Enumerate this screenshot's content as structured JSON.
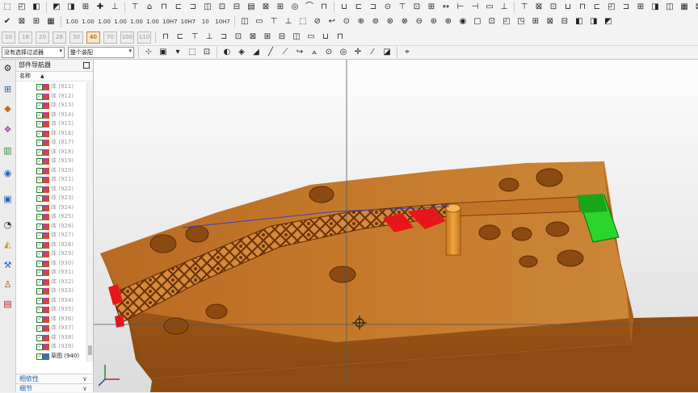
{
  "toolbar_row1": [
    "⬚",
    "◰",
    "◧",
    "◩",
    "◨",
    "⊞",
    "✚",
    "⊥",
    "⊤",
    "⌂",
    "⊓",
    "⊏",
    "⊐",
    "◫",
    "⊡",
    "⊟",
    "▤",
    "⊠",
    "⊞",
    "◎",
    "⌒",
    "⊓",
    "⊔",
    "⊏",
    "⊐",
    "⊙",
    "⊤",
    "⊡",
    "⊞",
    "↔",
    "⊢",
    "⊣",
    "▭",
    "⊥",
    "⊤",
    "⊠",
    "⊡",
    "⊔",
    "⊓",
    "⊏",
    "◰",
    "⊐",
    "⊞",
    "◨",
    "◫",
    "▦",
    "⊠",
    "⊡"
  ],
  "toolbar_row2_dims": [
    "1.00",
    "1.00",
    "1.00",
    "1.00",
    "1.00",
    "1.00",
    "10H7",
    "10H7",
    "10",
    "10H7"
  ],
  "toolbar_row2_icons": [
    "✔",
    "⊠",
    "⊞",
    "▦",
    "◫",
    "▭",
    "⊤",
    "⊥",
    "⬚",
    "⊘",
    "↩",
    "⊙",
    "⊕",
    "⊚",
    "⊛",
    "⊗",
    "⊖",
    "⊛",
    "⊕",
    "◉",
    "▢",
    "⊡",
    "◰",
    "◳",
    "⊞",
    "⊠",
    "⊟",
    "◧",
    "◨",
    "◩"
  ],
  "toolbar_row3_numbers": [
    "10",
    "18",
    "20",
    "28",
    "30",
    "40",
    "70",
    "100",
    "110"
  ],
  "toolbar_row3_icons": [
    "⊓",
    "⊏",
    "⊤",
    "⊥",
    "⊐",
    "⊡",
    "⊠",
    "⊞",
    "⊟",
    "◫",
    "▭",
    "⊔",
    "⊓"
  ],
  "filter": {
    "value": "没有选择过滤器"
  },
  "assembly": {
    "value": "整个装配"
  },
  "navigator": {
    "title": "部件导航器",
    "column_name": "名称"
  },
  "tree_items": [
    {
      "label": "体 (911)"
    },
    {
      "label": "体 (912)"
    },
    {
      "label": "体 (913)"
    },
    {
      "label": "体 (914)"
    },
    {
      "label": "体 (915)"
    },
    {
      "label": "体 (916)"
    },
    {
      "label": "体 (917)"
    },
    {
      "label": "体 (918)"
    },
    {
      "label": "体 (919)"
    },
    {
      "label": "体 (920)"
    },
    {
      "label": "体 (921)"
    },
    {
      "label": "体 (922)"
    },
    {
      "label": "体 (923)"
    },
    {
      "label": "体 (924)"
    },
    {
      "label": "体 (925)"
    },
    {
      "label": "体 (926)"
    },
    {
      "label": "体 (927)"
    },
    {
      "label": "体 (928)"
    },
    {
      "label": "体 (929)"
    },
    {
      "label": "体 (930)"
    },
    {
      "label": "体 (931)"
    },
    {
      "label": "体 (932)"
    },
    {
      "label": "体 (933)"
    },
    {
      "label": "体 (934)"
    },
    {
      "label": "体 (935)"
    },
    {
      "label": "体 (936)"
    },
    {
      "label": "体 (937)"
    },
    {
      "label": "体 (938)"
    },
    {
      "label": "体 (939)"
    },
    {
      "label": "草图 (940)",
      "sketch": true
    }
  ],
  "sections": {
    "dependency": "相依性",
    "details": "细节"
  },
  "colors": {
    "model_top": "#c57a2b",
    "model_side": "#9a5318",
    "insert_green": "#2bd52b",
    "highlight_red": "#e8161c",
    "pin": "#e59323"
  }
}
